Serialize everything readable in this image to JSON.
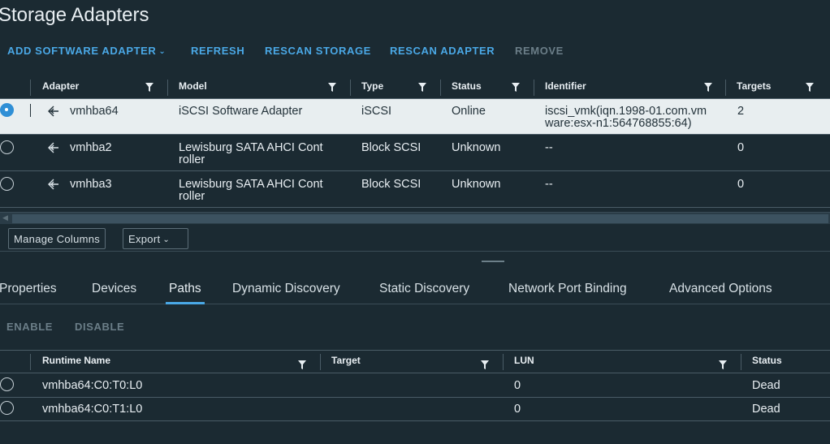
{
  "page": {
    "title": "Storage Adapters"
  },
  "toolbar": {
    "add_software_adapter": "ADD SOFTWARE ADAPTER",
    "refresh": "REFRESH",
    "rescan_storage": "RESCAN STORAGE",
    "rescan_adapter": "RESCAN ADAPTER",
    "remove": "REMOVE"
  },
  "adapters_grid": {
    "columns": [
      "Adapter",
      "Model",
      "Type",
      "Status",
      "Identifier",
      "Targets"
    ],
    "rows": [
      {
        "adapter": "vmhba64",
        "model_l1": "iSCSI Software Adapter",
        "model_l2": "",
        "type": "iSCSI",
        "status": "Online",
        "identifier_l1": "iscsi_vmk(iqn.1998-01.com.vm",
        "identifier_l2": "ware:esx-n1:564768855:64)",
        "targets": "2",
        "selected": true
      },
      {
        "adapter": "vmhba2",
        "model_l1": "Lewisburg SATA AHCI Cont",
        "model_l2": "roller",
        "type": "Block SCSI",
        "status": "Unknown",
        "identifier_l1": "--",
        "identifier_l2": "",
        "targets": "0",
        "selected": false
      },
      {
        "adapter": "vmhba3",
        "model_l1": "Lewisburg SATA AHCI Cont",
        "model_l2": "roller",
        "type": "Block SCSI",
        "status": "Unknown",
        "identifier_l1": "--",
        "identifier_l2": "",
        "targets": "0",
        "selected": false
      }
    ],
    "manage_columns": "Manage Columns",
    "export": "Export"
  },
  "tabs": [
    "Properties",
    "Devices",
    "Paths",
    "Dynamic Discovery",
    "Static Discovery",
    "Network Port Binding",
    "Advanced Options"
  ],
  "active_tab": "Paths",
  "paths_toolbar": {
    "enable": "ENABLE",
    "disable": "DISABLE"
  },
  "paths_grid": {
    "columns": [
      "Runtime Name",
      "Target",
      "LUN",
      "Status"
    ],
    "rows": [
      {
        "runtime_name": "vmhba64:C0:T0:L0",
        "target": "",
        "lun": "0",
        "status": "Dead"
      },
      {
        "runtime_name": "vmhba64:C0:T1:L0",
        "target": "",
        "lun": "0",
        "status": "Dead"
      }
    ]
  },
  "colors": {
    "accent": "#4aa8e6",
    "background": "#1b2a32",
    "selected_row": "#e8eef0",
    "disabled": "#6b7e88"
  },
  "icons": {
    "filter": "filter-icon",
    "adapter": "adapter-icon",
    "chevron": "chevron-down-icon"
  }
}
